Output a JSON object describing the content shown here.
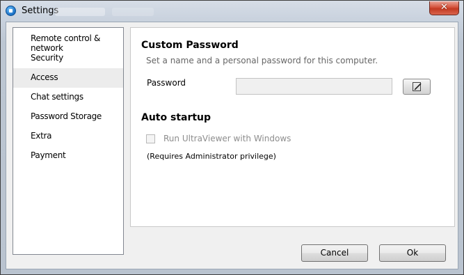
{
  "window": {
    "title": "Settings"
  },
  "titlebar": {
    "close_glyph": "✕"
  },
  "sidebar": {
    "items": [
      {
        "label": "Remote control & network"
      },
      {
        "label": "Security"
      },
      {
        "label": "Access"
      },
      {
        "label": "Chat settings"
      },
      {
        "label": "Password Storage"
      },
      {
        "label": "Extra"
      },
      {
        "label": "Payment"
      }
    ]
  },
  "content": {
    "custom_password": {
      "heading": "Custom Password",
      "description": "Set a name and a personal password for this computer.",
      "password_label": "Password",
      "password_value": "",
      "edit_icon": "pencil-icon"
    },
    "auto_startup": {
      "heading": "Auto startup",
      "checkbox_label": "Run UltraViewer with Windows",
      "checkbox_checked": false,
      "note": "(Requires Administrator privilege)"
    }
  },
  "footer": {
    "cancel_label": "Cancel",
    "ok_label": "Ok"
  },
  "colors": {
    "close_button": "#c23a22",
    "active_nav": "#ececec",
    "window_frame": "#bcc6d2"
  }
}
